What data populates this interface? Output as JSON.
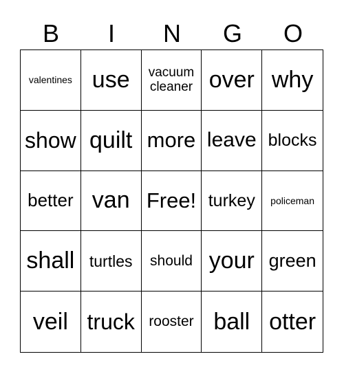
{
  "header": [
    "B",
    "I",
    "N",
    "G",
    "O"
  ],
  "cells": [
    [
      "valentines",
      "use",
      "vacuum cleaner",
      "over",
      "why"
    ],
    [
      "show",
      "quilt",
      "more",
      "leave",
      "blocks"
    ],
    [
      "better",
      "van",
      "Free!",
      "turkey",
      "policeman"
    ],
    [
      "shall",
      "turtles",
      "should",
      "your",
      "green"
    ],
    [
      "veil",
      "truck",
      "rooster",
      "ball",
      "otter"
    ]
  ]
}
